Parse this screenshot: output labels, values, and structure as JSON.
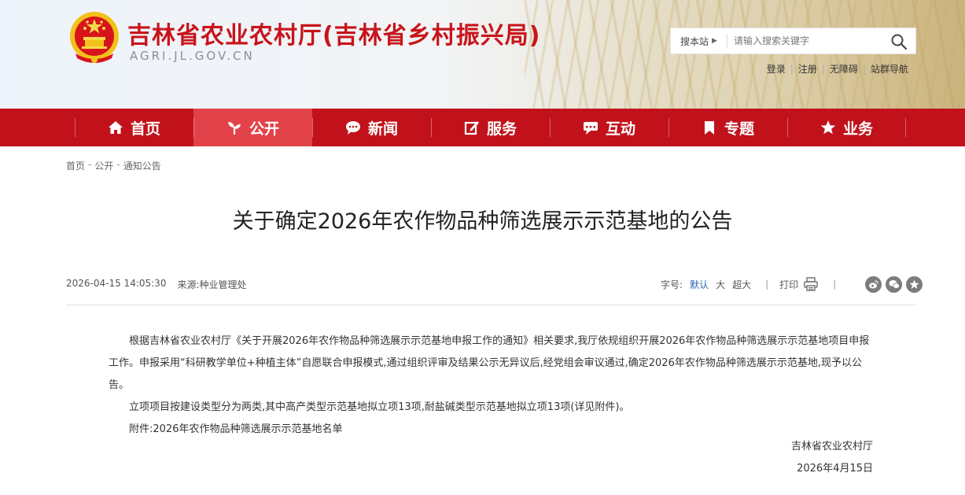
{
  "header": {
    "site_title": "吉林省农业农村厅(吉林省乡村振兴局)",
    "site_domain": "AGRI.JL.GOV.CN",
    "search": {
      "scope_label": "搜本站",
      "placeholder": "请输入搜索关键字"
    },
    "top_links": [
      "登录",
      "注册",
      "无障碍",
      "站群导航"
    ]
  },
  "nav": {
    "items": [
      {
        "label": "首页",
        "icon": "home-icon"
      },
      {
        "label": "公开",
        "icon": "sprout-icon",
        "active": true
      },
      {
        "label": "新闻",
        "icon": "chat-bubble-icon"
      },
      {
        "label": "服务",
        "icon": "edit-icon"
      },
      {
        "label": "互动",
        "icon": "chat-dots-icon"
      },
      {
        "label": "专题",
        "icon": "bookmark-icon"
      },
      {
        "label": "业务",
        "icon": "star-icon"
      }
    ]
  },
  "breadcrumb": [
    "首页",
    "公开",
    "通知公告"
  ],
  "article": {
    "title": "关于确定2026年农作物品种筛选展示示范基地的公告",
    "date": "2026-04-15 14:05:30",
    "source_label": "来源:",
    "source": "种业管理处",
    "font_size_label": "字号:",
    "font_sizes": [
      "默认",
      "大",
      "超大"
    ],
    "print_label": "打印",
    "paragraphs": [
      "根据吉林省农业农村厅《关于开展2026年农作物品种筛选展示示范基地申报工作的通知》相关要求,我厅依规组织开展2026年农作物品种筛选展示示范基地项目申报工作。申报采用“科研教学单位+种植主体”自愿联合申报模式,通过组织评审及结果公示无异议后,经党组会审议通过,确定2026年农作物品种筛选展示示范基地,现予以公告。",
      "立项项目按建设类型分为两类,其中高产类型示范基地拟立项13项,耐盐碱类型示范基地拟立项13项(详见附件)。",
      "附件:2026年农作物品种筛选展示示范基地名单"
    ],
    "signature_org": "吉林省农业农村厅",
    "signature_date": "2026年4月15日"
  },
  "colors": {
    "brand_red": "#c1121b",
    "nav_active": "#e2434a",
    "link_blue": "#2a66b6"
  }
}
